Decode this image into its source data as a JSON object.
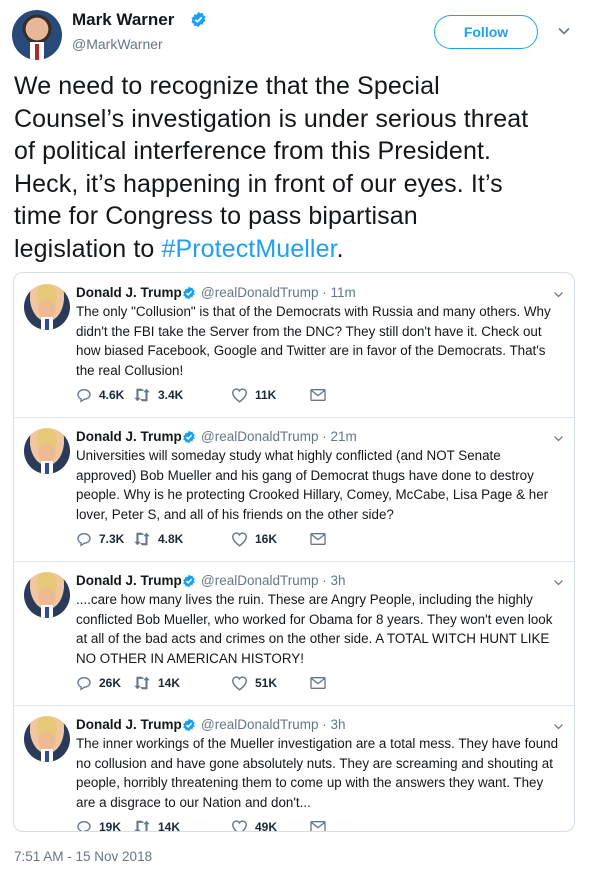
{
  "author": {
    "name": "Mark Warner",
    "handle": "@MarkWarner",
    "follow_label": "Follow"
  },
  "tweet": {
    "lines": [
      "We need to recognize that the Special",
      "Counsel’s investigation is under serious threat",
      "of political interference from this President.",
      "Heck, it’s happening in front of our eyes. It’s",
      "time for Congress to pass bipartisan"
    ],
    "last_line_prefix": "legislation to ",
    "hashtag": "#ProtectMueller",
    "last_line_suffix": ".",
    "timestamp": "7:51 AM - 15 Nov 2018"
  },
  "quoted": [
    {
      "name": "Donald J. Trump",
      "handle": "@realDonaldTrump · 11m",
      "lines": [
        "The only \"Collusion\" is that of the Democrats with Russia and many others. Why",
        "didn't the FBI take the Server from the DNC? They still don't have it. Check out",
        "how biased Facebook, Google and Twitter are in favor of the Democrats. That's",
        "the real Collusion!"
      ],
      "replies": "4.6K",
      "retweets": "3.4K",
      "likes": "11K"
    },
    {
      "name": "Donald J. Trump",
      "handle": "@realDonaldTrump · 21m",
      "lines": [
        "Universities will someday study what highly conflicted (and NOT Senate",
        "approved) Bob Mueller and his gang of Democrat thugs have done to destroy",
        "people. Why is he protecting Crooked Hillary, Comey, McCabe, Lisa Page & her",
        "lover, Peter S, and all of his friends on the other side?"
      ],
      "replies": "7.3K",
      "retweets": "4.8K",
      "likes": "16K"
    },
    {
      "name": "Donald J. Trump",
      "handle": "@realDonaldTrump · 3h",
      "lines": [
        "....care how many lives the ruin. These are Angry People, including the highly",
        "conflicted Bob Mueller, who worked for Obama for 8 years. They won't even look",
        "at all of the bad acts and crimes on the other side. A TOTAL WITCH HUNT LIKE",
        "NO OTHER IN AMERICAN HISTORY!"
      ],
      "replies": "26K",
      "retweets": "14K",
      "likes": "51K"
    },
    {
      "name": "Donald J. Trump",
      "handle": "@realDonaldTrump · 3h",
      "lines": [
        "The inner workings of the Mueller investigation are a total mess. They have found",
        "no collusion and have gone absolutely nuts. They are screaming and shouting at",
        "people, horribly threatening them to come up with the answers they want. They",
        "are a disgrace to our Nation and don't..."
      ],
      "replies": "19K",
      "retweets": "14K",
      "likes": "49K"
    }
  ],
  "colors": {
    "accent": "#1da1f2",
    "text": "#14171a",
    "secondary": "#657786"
  },
  "icons": [
    "verified-badge-icon",
    "chevron-down-icon",
    "reply-icon",
    "retweet-icon",
    "like-icon",
    "direct-message-icon"
  ]
}
